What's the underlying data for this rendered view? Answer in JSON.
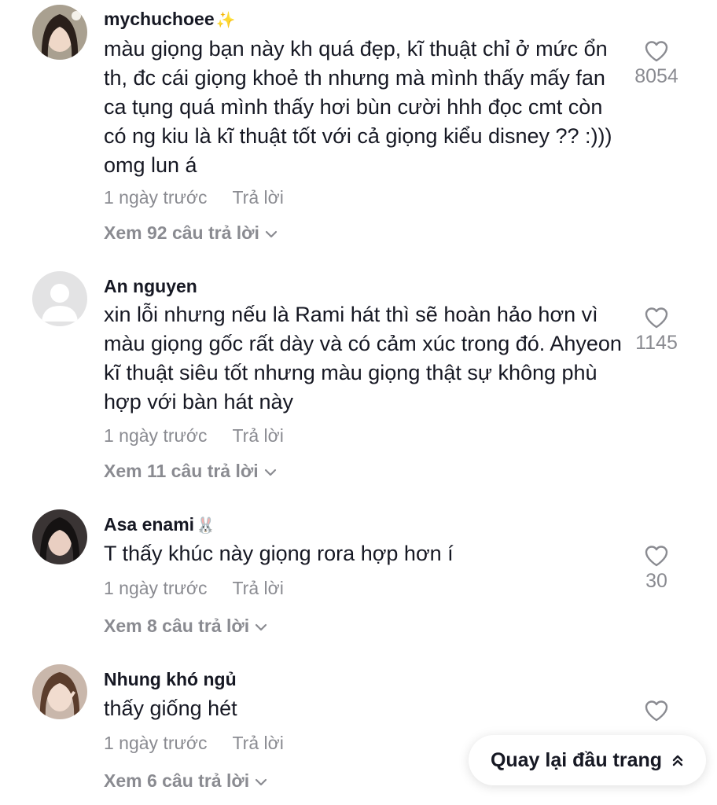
{
  "comments": [
    {
      "username": "mychuchoee",
      "badge": "✨",
      "text": "màu giọng bạn này kh quá đẹp, kĩ thuật chỉ ở mức ổn th, đc cái giọng khoẻ th nhưng mà mình thấy mấy fan ca tụng quá mình thấy hơi bùn cười hhh đọc cmt còn có ng kiu là kĩ thuật tốt với cả giọng kiểu disney ?? :))) omg lun á",
      "time": "1 ngày trước",
      "reply_label": "Trả lời",
      "view_replies": "Xem 92 câu trả lời",
      "likes": "8054",
      "avatar": "user-photo"
    },
    {
      "username": "An nguyen",
      "badge": "",
      "text": "xin lỗi nhưng nếu là Rami hát thì sẽ hoàn hảo hơn vì màu giọng gốc rất dày và có cảm xúc trong đó. Ahyeon kĩ thuật siêu tốt nhưng màu giọng thật sự không phù hợp với bàn hát này",
      "time": "1 ngày trước",
      "reply_label": "Trả lời",
      "view_replies": "Xem 11 câu trả lời",
      "likes": "1145",
      "avatar": "default-avatar"
    },
    {
      "username": "Asa enami",
      "badge": "🐰",
      "text": "T thấy khúc này giọng rora hợp hơn í",
      "time": "1 ngày trước",
      "reply_label": "Trả lời",
      "view_replies": "Xem 8 câu trả lời",
      "likes": "30",
      "avatar": "user-photo"
    },
    {
      "username": "Nhung khó ngủ",
      "badge": "",
      "text": "thấy giống hét",
      "time": "1 ngày trước",
      "reply_label": "Trả lời",
      "view_replies": "Xem 6 câu trả lời",
      "likes": "",
      "avatar": "user-photo"
    }
  ],
  "back_to_top": {
    "label": "Quay lại đầu trang",
    "icon": "double-chevron-up-icon"
  },
  "colors": {
    "text": "#161823",
    "muted": "#8a8b91",
    "background": "#ffffff"
  }
}
